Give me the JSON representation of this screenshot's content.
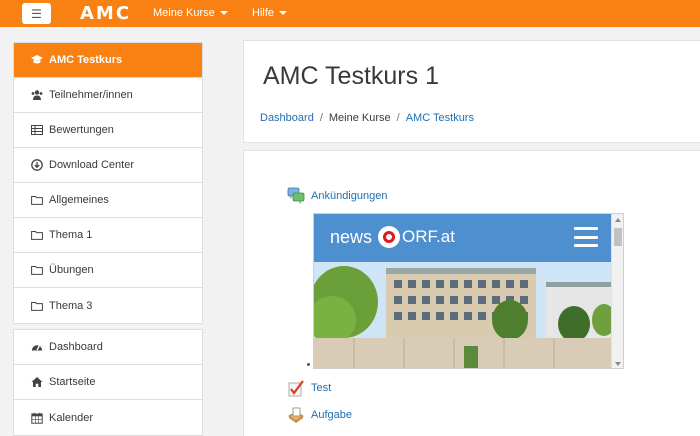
{
  "navbar": {
    "menu_icon": "☰",
    "brand": "AMC",
    "menus": [
      {
        "label": "Meine Kurse"
      },
      {
        "label": "Hilfe"
      }
    ],
    "color": "#f98012"
  },
  "sidebar": {
    "course_items": [
      {
        "label": "AMC Testkurs",
        "icon": "graduation-cap-icon",
        "active": true
      },
      {
        "label": "Teilnehmer/innen",
        "icon": "users-icon"
      },
      {
        "label": "Bewertungen",
        "icon": "table-icon"
      },
      {
        "label": "Download Center",
        "icon": "download-icon"
      },
      {
        "label": "Allgemeines",
        "icon": "folder-icon"
      },
      {
        "label": "Thema 1",
        "icon": "folder-icon"
      },
      {
        "label": "Übungen",
        "icon": "folder-icon"
      },
      {
        "label": "Thema 3",
        "icon": "folder-icon"
      }
    ],
    "site_items": [
      {
        "label": "Dashboard",
        "icon": "dashboard-icon"
      },
      {
        "label": "Startseite",
        "icon": "home-icon"
      },
      {
        "label": "Kalender",
        "icon": "calendar-icon"
      }
    ]
  },
  "header": {
    "title": "AMC Testkurs 1",
    "breadcrumb": [
      {
        "label": "Dashboard",
        "link": true
      },
      {
        "label": "Meine Kurse",
        "link": false
      },
      {
        "label": "AMC Testkurs",
        "link": true
      }
    ],
    "separator": "/"
  },
  "content": {
    "activities": [
      {
        "label": "Ankündigungen",
        "icon": "forum-icon"
      },
      {
        "label": "Test",
        "icon": "quiz-icon"
      },
      {
        "label": "Aufgabe",
        "icon": "assignment-icon"
      }
    ],
    "news": {
      "logo_text": "news",
      "logo_suffix": "ORF.at",
      "header_color": "#4d8fcf"
    }
  }
}
